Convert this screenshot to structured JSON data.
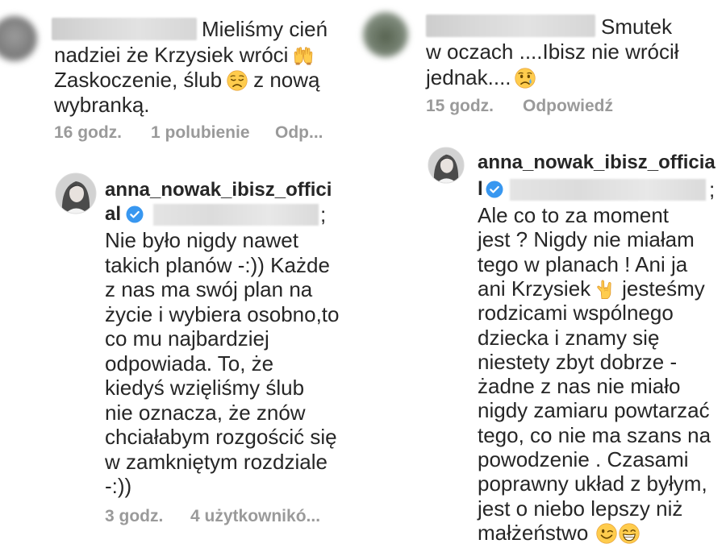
{
  "left_panel": {
    "comment": {
      "line_1": "Mieliśmy cień",
      "line_2": {
        "text": "nadziei że Krzysiek wróci",
        "emoji": "raised-hands"
      },
      "line_3": {
        "before": "Zaskoczenie, ślub",
        "emoji": "disappointed-face",
        "after": "z nową"
      },
      "line_4": "wybranką.",
      "time": "16 godz.",
      "likes": "1 polubienie",
      "reply_label": "Odp..."
    },
    "reply": {
      "username_line_1": "anna_nowak_ibisz_offici",
      "username_line_2": "al",
      "badge": "verified-badge",
      "mention_end": ";",
      "lines": [
        "Nie było nigdy nawet",
        "takich planów -:)) Każde",
        "z nas ma swój plan na",
        "życie i wybiera osobno,to",
        "co mu najbardziej",
        "odpowiada. To, że",
        "kiedyś wzięliśmy ślub",
        "nie oznacza, że znów",
        "chciałabym rozgościć się",
        "w zamkniętym rozdziale",
        "-:))"
      ],
      "time": "3 godz.",
      "likes": "4 użytkownikó..."
    }
  },
  "right_panel": {
    "comment": {
      "line_1": "Smutek",
      "line_2": "w oczach ....Ibisz nie wrócił",
      "line_3": {
        "text": "jednak....",
        "emoji": "crying-face"
      },
      "time": "15 godz.",
      "reply_label": "Odpowiedź"
    },
    "reply": {
      "username_line_1": "anna_nowak_ibisz_officia",
      "username_line_2": "l",
      "badge": "verified-badge",
      "mention_end": ";",
      "lines": [
        "Ale co to za moment",
        "jest ? Nigdy nie miałam",
        "tego w planach ! Ani ja",
        {
          "before": "ani Krzysiek",
          "emoji": "love-you-gesture",
          "after": "jesteśmy"
        },
        "rodzicami wspólnego",
        "dziecka i znamy się",
        "niestety zbyt dobrze -",
        "żadne z nas nie miało",
        "nigdy zamiaru powtarzać",
        "tego, co nie ma szans na",
        "powodzenie . Czasami",
        "poprawny układ z byłym,",
        "jest o niebo lepszy niż",
        {
          "text": "małżeństwo",
          "emoji": [
            "winking-face",
            "beaming-face-with-smiling-eyes"
          ]
        }
      ]
    }
  },
  "colors": {
    "text": "#262626",
    "meta": "#9a9a9a",
    "verified": "#3897f0",
    "emoji_yellow": "#ffcc4d"
  }
}
